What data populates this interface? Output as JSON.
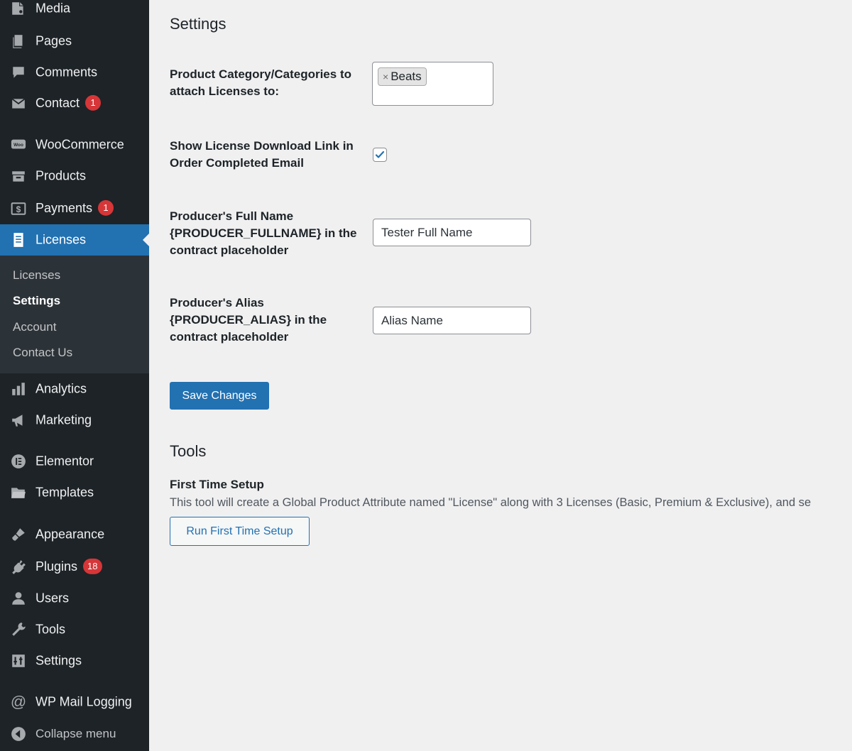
{
  "sidebar": {
    "items": [
      {
        "label": "Media",
        "icon": "media-icon"
      },
      {
        "label": "Pages",
        "icon": "pages-icon"
      },
      {
        "label": "Comments",
        "icon": "comments-icon"
      },
      {
        "label": "Contact",
        "icon": "mail-icon",
        "badge": "1"
      },
      {
        "label": "WooCommerce",
        "icon": "woocommerce-icon"
      },
      {
        "label": "Products",
        "icon": "products-icon"
      },
      {
        "label": "Payments",
        "icon": "payments-icon",
        "badge": "1"
      },
      {
        "label": "Licenses",
        "icon": "licenses-icon"
      },
      {
        "label": "Analytics",
        "icon": "analytics-icon"
      },
      {
        "label": "Marketing",
        "icon": "megaphone-icon"
      },
      {
        "label": "Elementor",
        "icon": "elementor-icon"
      },
      {
        "label": "Templates",
        "icon": "folder-icon"
      },
      {
        "label": "Appearance",
        "icon": "brush-icon"
      },
      {
        "label": "Plugins",
        "icon": "plugin-icon",
        "badge": "18"
      },
      {
        "label": "Users",
        "icon": "user-icon"
      },
      {
        "label": "Tools",
        "icon": "wrench-icon"
      },
      {
        "label": "Settings",
        "icon": "settings-icon"
      },
      {
        "label": "WP Mail Logging",
        "icon": "at-icon"
      },
      {
        "label": "Collapse menu",
        "icon": "collapse-icon"
      }
    ],
    "submenu": [
      "Licenses",
      "Settings",
      "Account",
      "Contact Us"
    ],
    "active_accent": "#2271b1",
    "badge_color": "#d63638"
  },
  "settings": {
    "title": "Settings",
    "category_label": "Product Category/Categories to attach Licenses to:",
    "category_tag": "Beats",
    "download_link_label": "Show License Download Link in Order Completed Email",
    "download_link_checked": true,
    "fullname_label": "Producer's Full Name {PRODUCER_FULLNAME} in the contract placeholder",
    "fullname_value": "Tester Full Name",
    "alias_label": "Producer's Alias {PRODUCER_ALIAS} in the contract placeholder",
    "alias_value": "Alias Name",
    "save_label": "Save Changes"
  },
  "tools": {
    "title": "Tools",
    "setup_title": "First Time Setup",
    "setup_desc": "This tool will create a Global Product Attribute named \"License\" along with 3 Licenses (Basic, Premium & Exclusive), and se",
    "setup_button": "Run First Time Setup"
  }
}
